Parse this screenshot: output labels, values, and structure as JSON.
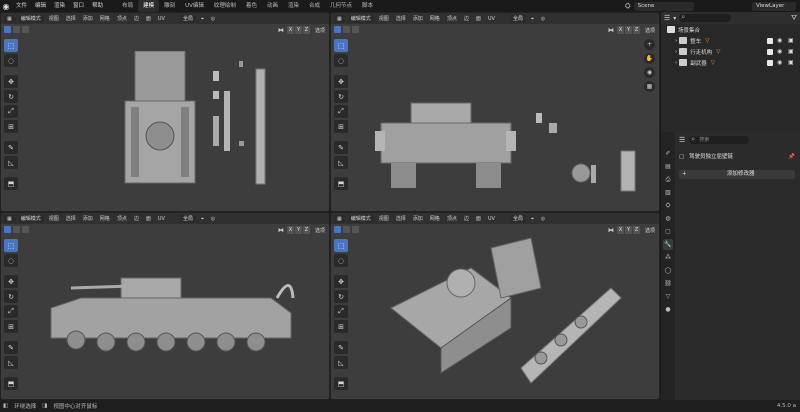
{
  "menu": [
    "文件",
    "编辑",
    "渲染",
    "窗口",
    "帮助"
  ],
  "workspaces": [
    "布局",
    "建模",
    "雕刻",
    "UV编辑",
    "纹理绘制",
    "着色",
    "动画",
    "渲染",
    "合成",
    "几何节点",
    "脚本"
  ],
  "active_workspace": "建模",
  "scene": "Scene",
  "view_layer": "ViewLayer",
  "viewport": {
    "mode": "编辑模式",
    "menus": [
      "视图",
      "选择",
      "添加",
      "网格",
      "顶点",
      "边",
      "面",
      "UV"
    ],
    "global": "全局",
    "x": "X",
    "y": "Y",
    "z": "Z",
    "options": "选项"
  },
  "outliner": {
    "search_placeholder": "",
    "collection": "场景集合",
    "items": [
      {
        "label": "整车"
      },
      {
        "label": "行走机构"
      },
      {
        "label": "副武器"
      }
    ]
  },
  "properties": {
    "search_placeholder": "搜索",
    "modifier_object": "驾驶员独立屈壁链",
    "add_modifier": "添加修改器"
  },
  "status": {
    "select": "环绕选择",
    "center": "视图中心对齐鼠标",
    "version": "4.5.0 a"
  },
  "colors": {
    "accent": "#4a75c2",
    "viewport_bg": "#3d3d3d",
    "panel": "#2b2b2b"
  }
}
